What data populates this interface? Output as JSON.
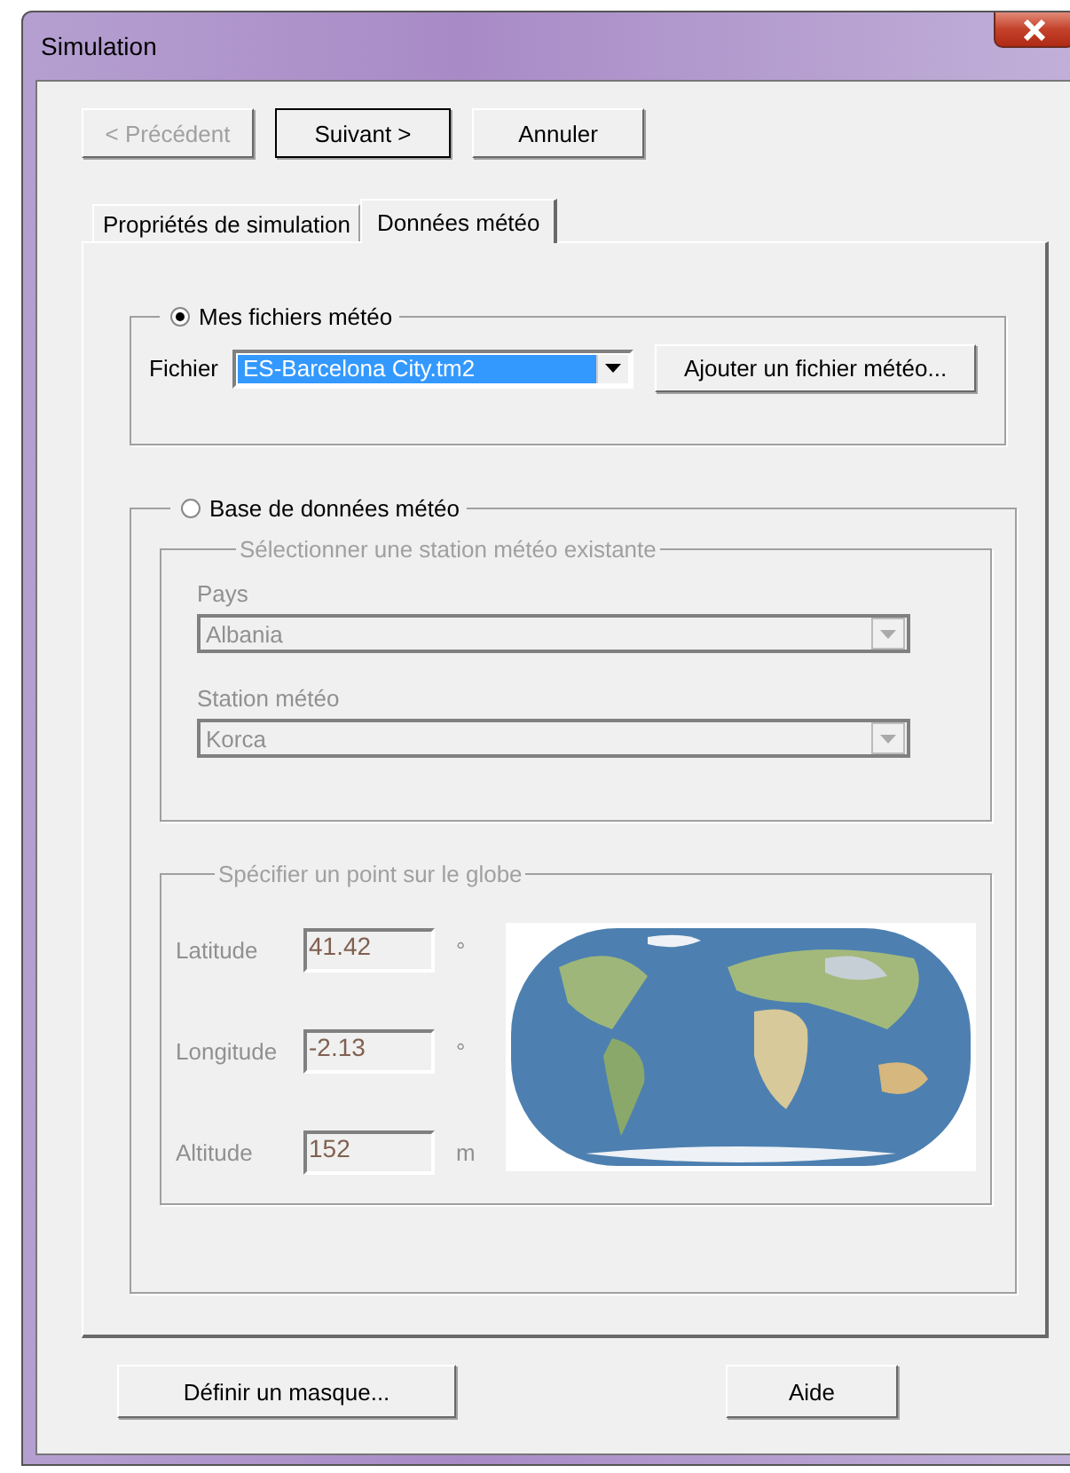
{
  "window": {
    "title": "Simulation"
  },
  "nav_buttons": [
    {
      "label": "< Précédent",
      "disabled": true,
      "default": false
    },
    {
      "label": "Suivant >",
      "disabled": false,
      "default": true
    },
    {
      "label": "Annuler",
      "disabled": false,
      "default": false
    }
  ],
  "tabs": [
    {
      "label": "Propriétés de simulation",
      "selected": false
    },
    {
      "label": "Données météo",
      "selected": true
    }
  ],
  "my_files": {
    "label": "Mes fichiers météo",
    "selected": true,
    "file_label": "Fichier",
    "file_value": "ES-Barcelona City.tm2",
    "add_button": "Ajouter un fichier météo..."
  },
  "database": {
    "label": "Base de données météo",
    "selected": false,
    "disabled": true,
    "station_group": {
      "legend": "Sélectionner une station météo existante",
      "country_label": "Pays",
      "country_value": "Albania",
      "station_label": "Station météo",
      "station_value": "Korca"
    },
    "point_group": {
      "legend": "Spécifier un point sur le globe",
      "fields": [
        {
          "label": "Latitude",
          "value": "41.42",
          "unit": "°"
        },
        {
          "label": "Longitude",
          "value": "-2.13",
          "unit": "°"
        },
        {
          "label": "Altitude",
          "value": "152",
          "unit": "m"
        }
      ]
    }
  },
  "bottom_buttons": [
    {
      "label": "Définir un masque..."
    },
    {
      "label": "Aide"
    }
  ]
}
